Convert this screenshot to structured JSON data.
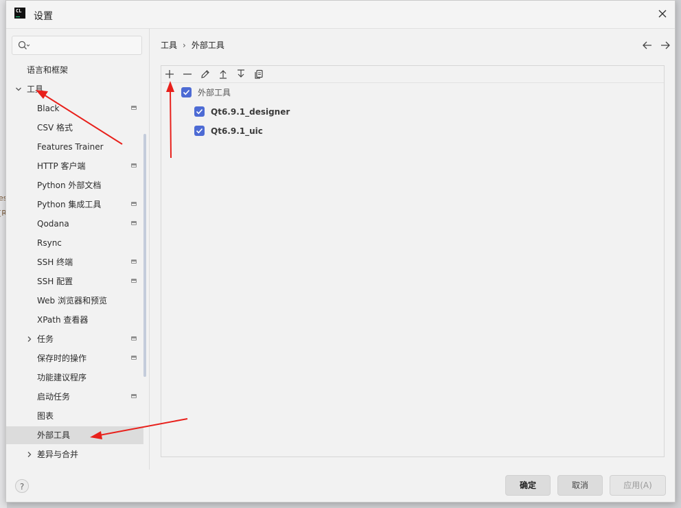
{
  "window": {
    "title": "设置",
    "app_icon_text": "CL"
  },
  "search": {
    "placeholder": "",
    "value": ""
  },
  "sidebar": {
    "items": [
      {
        "label": "语言和框架",
        "level": 0,
        "expanded": null,
        "has_project_icon": false,
        "selected": false
      },
      {
        "label": "工具",
        "level": 0,
        "expanded": true,
        "has_project_icon": false,
        "selected": false
      },
      {
        "label": "Black",
        "level": 1,
        "expanded": null,
        "has_project_icon": true,
        "selected": false
      },
      {
        "label": "CSV 格式",
        "level": 1,
        "expanded": null,
        "has_project_icon": false,
        "selected": false
      },
      {
        "label": "Features Trainer",
        "level": 1,
        "expanded": null,
        "has_project_icon": false,
        "selected": false
      },
      {
        "label": "HTTP 客户端",
        "level": 1,
        "expanded": null,
        "has_project_icon": true,
        "selected": false
      },
      {
        "label": "Python 外部文档",
        "level": 1,
        "expanded": null,
        "has_project_icon": false,
        "selected": false
      },
      {
        "label": "Python 集成工具",
        "level": 1,
        "expanded": null,
        "has_project_icon": true,
        "selected": false
      },
      {
        "label": "Qodana",
        "level": 1,
        "expanded": null,
        "has_project_icon": true,
        "selected": false
      },
      {
        "label": "Rsync",
        "level": 1,
        "expanded": null,
        "has_project_icon": false,
        "selected": false
      },
      {
        "label": "SSH 终端",
        "level": 1,
        "expanded": null,
        "has_project_icon": true,
        "selected": false
      },
      {
        "label": "SSH 配置",
        "level": 1,
        "expanded": null,
        "has_project_icon": true,
        "selected": false
      },
      {
        "label": "Web 浏览器和预览",
        "level": 1,
        "expanded": null,
        "has_project_icon": false,
        "selected": false
      },
      {
        "label": "XPath 查看器",
        "level": 1,
        "expanded": null,
        "has_project_icon": false,
        "selected": false
      },
      {
        "label": "任务",
        "level": 1,
        "expanded": false,
        "has_project_icon": true,
        "selected": false
      },
      {
        "label": "保存时的操作",
        "level": 1,
        "expanded": null,
        "has_project_icon": true,
        "selected": false
      },
      {
        "label": "功能建议程序",
        "level": 1,
        "expanded": null,
        "has_project_icon": false,
        "selected": false
      },
      {
        "label": "启动任务",
        "level": 1,
        "expanded": null,
        "has_project_icon": true,
        "selected": false
      },
      {
        "label": "图表",
        "level": 1,
        "expanded": null,
        "has_project_icon": false,
        "selected": false
      },
      {
        "label": "外部工具",
        "level": 1,
        "expanded": null,
        "has_project_icon": false,
        "selected": true
      },
      {
        "label": "差异与合并",
        "level": 1,
        "expanded": false,
        "has_project_icon": false,
        "selected": false
      }
    ]
  },
  "breadcrumb": {
    "parent": "工具",
    "current": "外部工具"
  },
  "toolbar": {
    "buttons": [
      "plus-icon",
      "minus-icon",
      "edit-pencil-icon",
      "move-up-icon",
      "move-down-icon",
      "copy-icon"
    ]
  },
  "external_tools": {
    "group": {
      "label": "外部工具",
      "checked": true
    },
    "tools": [
      {
        "label": "Qt6.9.1_designer",
        "checked": true
      },
      {
        "label": "Qt6.9.1_uic",
        "checked": true
      }
    ]
  },
  "footer": {
    "help_label": "?",
    "ok_label": "确定",
    "cancel_label": "取消",
    "apply_label": "应用(A)"
  },
  "colors": {
    "checkbox": "#4d6bd4",
    "annotation_arrow": "#e8201b",
    "selected_row": "#dcdcdc",
    "scrollbar": "#c4ccdb"
  }
}
